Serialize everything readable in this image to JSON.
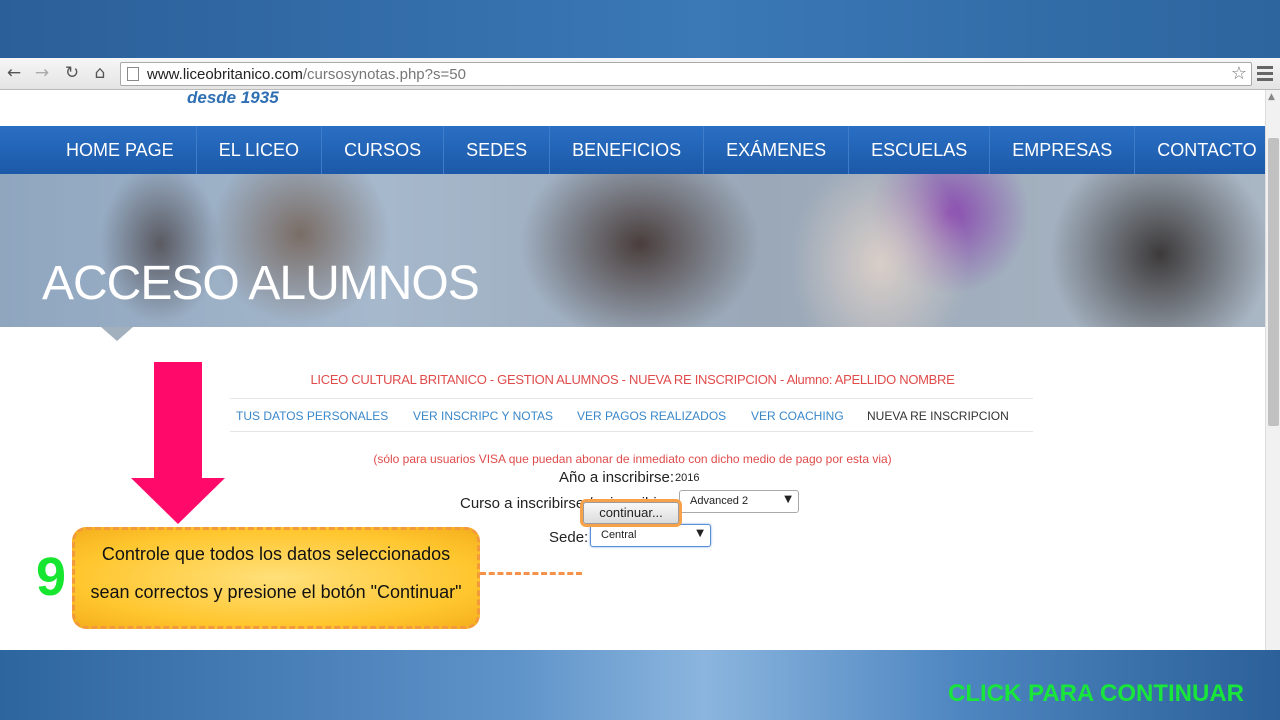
{
  "browser": {
    "url_host": "www.liceobritanico.com",
    "url_path": "/cursosynotas.php?s=50"
  },
  "site": {
    "tagline": "desde 1935",
    "nav": [
      "HOME PAGE",
      "EL LICEO",
      "CURSOS",
      "SEDES",
      "BENEFICIOS",
      "EXÁMENES",
      "ESCUELAS",
      "EMPRESAS",
      "CONTACTO"
    ],
    "hero_title": "ACCESO ALUMNOS"
  },
  "gestion": {
    "title": "LICEO CULTURAL BRITANICO - GESTION ALUMNOS - NUEVA RE INSCRIPCION - Alumno: APELLIDO NOMBRE",
    "subnav": [
      "TUS DATOS PERSONALES",
      "VER INSCRIPC Y NOTAS",
      "VER PAGOS REALIZADOS",
      "VER COACHING",
      "NUEVA RE INSCRIPCION"
    ],
    "visa_note": "(sólo para usuarios VISA que puedan abonar de inmediato con dicho medio de pago por esta via)"
  },
  "form": {
    "year_label": "Año a inscribirse:",
    "year_value": "2016",
    "course_label": "Curso a inscribirse / reinscribirse:",
    "course_value": "Advanced 2",
    "sede_label": "Sede:",
    "sede_value": "Central",
    "continue_label": "continuar..."
  },
  "annotation": {
    "step": "9",
    "line1": "Controle que todos los datos seleccionados",
    "line2": "sean correctos y presione el botón \"Continuar\""
  },
  "slide": {
    "click_continue": "CLICK PARA CONTINUAR"
  },
  "colors": {
    "nav_blue": "#1c59a8",
    "gestion_red": "#e04c4c",
    "subnav_blue": "#3a87c8",
    "arrow_pink": "#ff0a6b",
    "callout_yellow": "#ffc62e",
    "step_green": "#17e630"
  }
}
